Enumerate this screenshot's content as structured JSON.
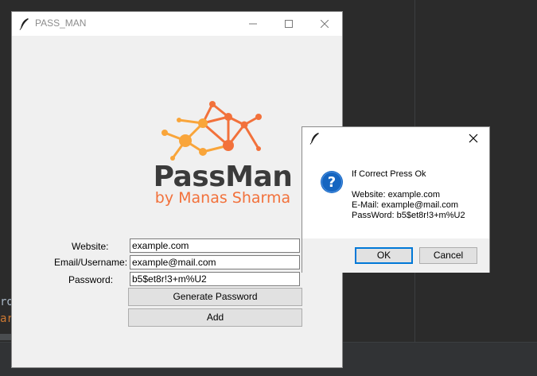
{
  "ide": {
    "line1": "ro",
    "line2": "ar"
  },
  "main_window": {
    "title": "PASS_MAN",
    "logo": {
      "title": "PassMan",
      "subtitle": "by Manas Sharma"
    },
    "form": {
      "website_label": "Website:",
      "email_label": "Email/Username:",
      "password_label": "Password:",
      "website_value": "example.com",
      "email_value": "example@mail.com",
      "password_value": "b5$et8r!3+m%U2"
    },
    "buttons": {
      "generate": "Generate Password",
      "add": "Add"
    }
  },
  "dialog": {
    "heading": "If Correct Press Ok",
    "website_line": "Website: example.com",
    "email_line": "E-Mail: example@mail.com",
    "password_line": "PassWord: b5$et8r!3+m%U2",
    "ok_label": "OK",
    "cancel_label": "Cancel"
  },
  "colors": {
    "logo_orange": "#f2713b",
    "logo_yellow": "#f9a53a",
    "logo_text": "#3b3b3b",
    "info_blue": "#1565c0",
    "focus_border": "#0078d7"
  },
  "icons": [
    "feather-icon",
    "minimize-icon",
    "maximize-icon",
    "close-icon",
    "question-icon",
    "network-logo-icon"
  ]
}
